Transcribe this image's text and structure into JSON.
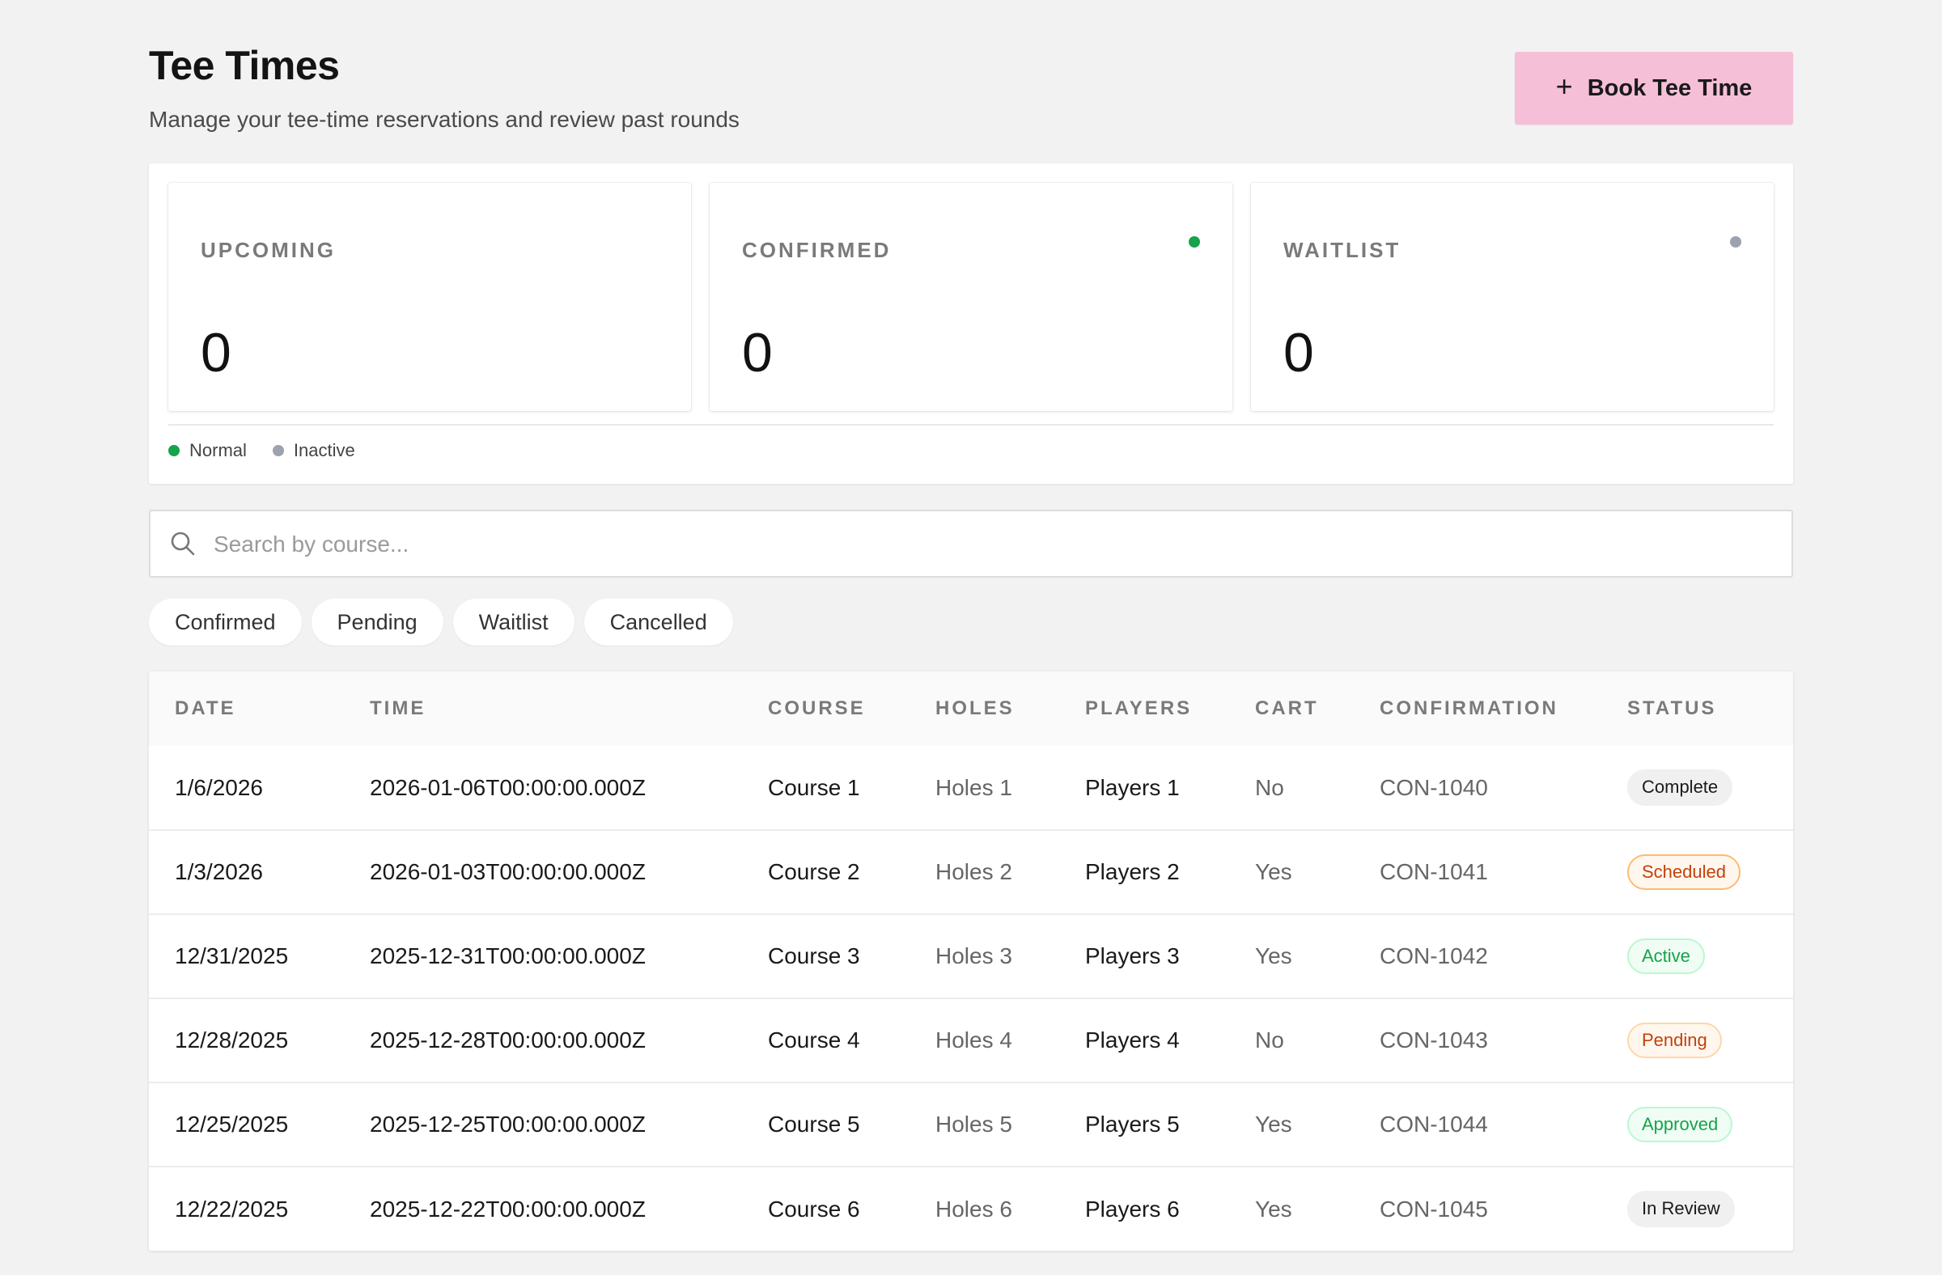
{
  "header": {
    "title": "Tee Times",
    "subtitle": "Manage your tee-time reservations and review past rounds",
    "book_button": {
      "icon": "plus-icon",
      "label": "Book Tee Time",
      "color": "#f6bfd8"
    }
  },
  "stats": [
    {
      "label": "UPCOMING",
      "value": "0",
      "dot": null
    },
    {
      "label": "CONFIRMED",
      "value": "0",
      "dot": "#16a34a"
    },
    {
      "label": "WAITLIST",
      "value": "0",
      "dot": "#9ca3af"
    }
  ],
  "legend": [
    {
      "label": "Normal",
      "color": "#16a34a"
    },
    {
      "label": "Inactive",
      "color": "#9ca3af"
    }
  ],
  "search": {
    "placeholder": "Search by course...",
    "value": "",
    "icon": "search-icon"
  },
  "filters": [
    "Confirmed",
    "Pending",
    "Waitlist",
    "Cancelled"
  ],
  "table": {
    "columns": [
      "DATE",
      "TIME",
      "COURSE",
      "HOLES",
      "PLAYERS",
      "CART",
      "CONFIRMATION",
      "STATUS"
    ],
    "rows": [
      {
        "date": "1/6/2026",
        "time": "2026-01-06T00:00:00.000Z",
        "course": "Course 1",
        "holes": "Holes 1",
        "players": "Players 1",
        "cart": "No",
        "confirmation": "CON-1040",
        "status": "Complete"
      },
      {
        "date": "1/3/2026",
        "time": "2026-01-03T00:00:00.000Z",
        "course": "Course 2",
        "holes": "Holes 2",
        "players": "Players 2",
        "cart": "Yes",
        "confirmation": "CON-1041",
        "status": "Scheduled"
      },
      {
        "date": "12/31/2025",
        "time": "2025-12-31T00:00:00.000Z",
        "course": "Course 3",
        "holes": "Holes 3",
        "players": "Players 3",
        "cart": "Yes",
        "confirmation": "CON-1042",
        "status": "Active"
      },
      {
        "date": "12/28/2025",
        "time": "2025-12-28T00:00:00.000Z",
        "course": "Course 4",
        "holes": "Holes 4",
        "players": "Players 4",
        "cart": "No",
        "confirmation": "CON-1043",
        "status": "Pending"
      },
      {
        "date": "12/25/2025",
        "time": "2025-12-25T00:00:00.000Z",
        "course": "Course 5",
        "holes": "Holes 5",
        "players": "Players 5",
        "cart": "Yes",
        "confirmation": "CON-1044",
        "status": "Approved"
      },
      {
        "date": "12/22/2025",
        "time": "2025-12-22T00:00:00.000Z",
        "course": "Course 6",
        "holes": "Holes 6",
        "players": "Players 6",
        "cart": "Yes",
        "confirmation": "CON-1045",
        "status": "In Review"
      }
    ]
  },
  "status_colors": {
    "Complete": {
      "bg": "#f0f0f0",
      "fg": "#1a1a1a",
      "border": "#f0f0f0"
    },
    "Scheduled": {
      "bg": "#fff7ed",
      "fg": "#c2410c",
      "border": "#fdba74"
    },
    "Active": {
      "bg": "#f0fdf4",
      "fg": "#16a34a",
      "border": "#bbf7d0"
    },
    "Pending": {
      "bg": "#fff7ed",
      "fg": "#c2410c",
      "border": "#fed7aa"
    },
    "Approved": {
      "bg": "#f0fdf4",
      "fg": "#16a34a",
      "border": "#bbf7d0"
    },
    "In Review": {
      "bg": "#f0f0f0",
      "fg": "#1a1a1a",
      "border": "#f0f0f0"
    }
  }
}
